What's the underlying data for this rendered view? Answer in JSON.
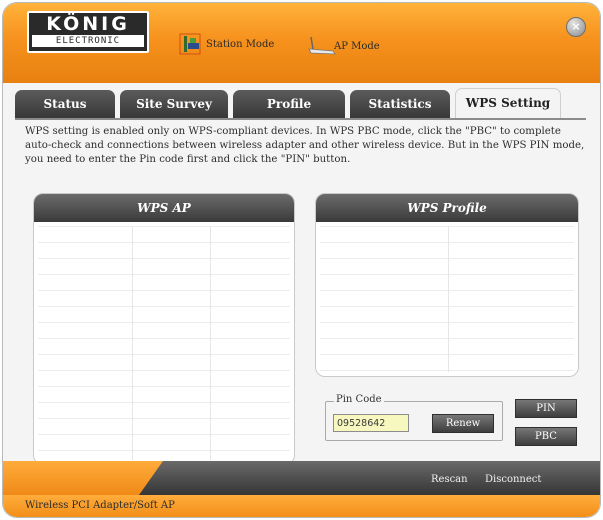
{
  "header": {
    "logo": {
      "line1": "KÖNIG",
      "line2": "ELECTRONIC"
    },
    "modes": [
      {
        "label": "Station Mode",
        "icon": "station-mode-icon"
      },
      {
        "label": "AP Mode",
        "icon": "ap-mode-icon"
      }
    ],
    "close_icon": "close-icon",
    "close_glyph": "×"
  },
  "tabs": [
    {
      "label": "Status",
      "active": false
    },
    {
      "label": "Site Survey",
      "active": false
    },
    {
      "label": "Profile",
      "active": false
    },
    {
      "label": "Statistics",
      "active": false
    },
    {
      "label": "WPS Setting",
      "active": true
    }
  ],
  "description": "WPS setting is enabled only on WPS-compliant devices. In WPS PBC mode, click the \"PBC\" to complete auto-check and connections between wireless adapter and other wireless device. But in the WPS PIN mode, you need to enter the Pin code first and click the \"PIN\" button.",
  "panels": {
    "wps_ap": {
      "title": "WPS AP"
    },
    "wps_profile": {
      "title": "WPS Profile"
    }
  },
  "pin": {
    "legend": "Pin Code",
    "value": "09528642",
    "renew_label": "Renew"
  },
  "buttons": {
    "pin_label": "PIN",
    "pbc_label": "PBC"
  },
  "footer": {
    "rescan_label": "Rescan",
    "disconnect_label": "Disconnect"
  },
  "status_bar": {
    "text": "Wireless PCI Adapter/Soft AP"
  },
  "colors": {
    "accent_orange": "#f6921d",
    "dark_gray": "#3a3a3a",
    "pin_field": "#f7f8c0"
  }
}
